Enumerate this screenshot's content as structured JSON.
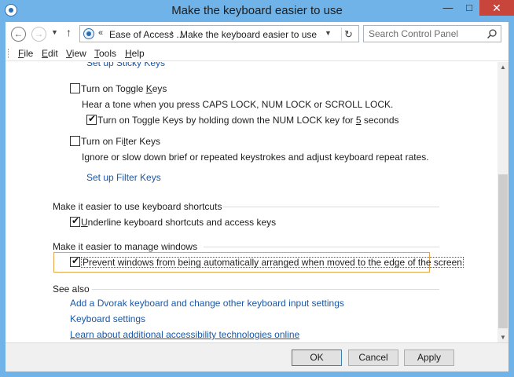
{
  "window": {
    "title": "Make the keyboard easier to use",
    "minimize_glyph": "—",
    "maximize_glyph": "□",
    "close_glyph": "✕"
  },
  "address": {
    "chevron": "«",
    "crumb1": "Ease of Access ...",
    "separator": "›",
    "crumb2": "Make the keyboard easier to use"
  },
  "search": {
    "placeholder": "Search Control Panel"
  },
  "menu": [
    {
      "key": "F",
      "rest": "ile"
    },
    {
      "key": "E",
      "rest": "dit"
    },
    {
      "key": "V",
      "rest": "iew"
    },
    {
      "key": "T",
      "rest": "ools"
    },
    {
      "key": "H",
      "rest": "elp"
    }
  ],
  "content": {
    "sticky_link": "Set up Sticky Keys",
    "toggle_keys": {
      "label_pre": "Turn on Toggle ",
      "label_key": "K",
      "label_post": "eys",
      "checked": false,
      "description": "Hear a tone when you press CAPS LOCK, NUM LOCK or SCROLL LOCK.",
      "sub_label_pre": "Turn on Toggle Keys by holding down the NUM LOCK key for ",
      "sub_label_key": "5",
      "sub_label_post": " seconds",
      "sub_checked": true
    },
    "filter_keys": {
      "label_pre": "Turn on Fi",
      "label_key": "l",
      "label_post": "ter Keys",
      "checked": false,
      "description": "Ignore or slow down brief or repeated keystrokes and adjust keyboard repeat rates.",
      "link": "Set up Filter Keys"
    },
    "shortcuts": {
      "header": "Make it easier to use keyboard shortcuts",
      "label_key": "U",
      "label_post": "nderline keyboard shortcuts and access keys",
      "checked": true
    },
    "windows": {
      "header": "Make it easier to manage windows",
      "label": "Prevent windows from being automatically arranged when moved to the edge of the screen",
      "checked": true
    },
    "see_also": {
      "header": "See also",
      "links": [
        "Add a Dvorak keyboard and change other keyboard input settings",
        "Keyboard settings",
        "Learn about additional accessibility technologies online"
      ]
    }
  },
  "buttons": {
    "ok": "OK",
    "cancel": "Cancel",
    "apply": "Apply"
  },
  "colors": {
    "frame": "#6fb3e8",
    "link": "#1a58a8",
    "highlight": "#e8a44a",
    "close_button": "#c7453b"
  }
}
